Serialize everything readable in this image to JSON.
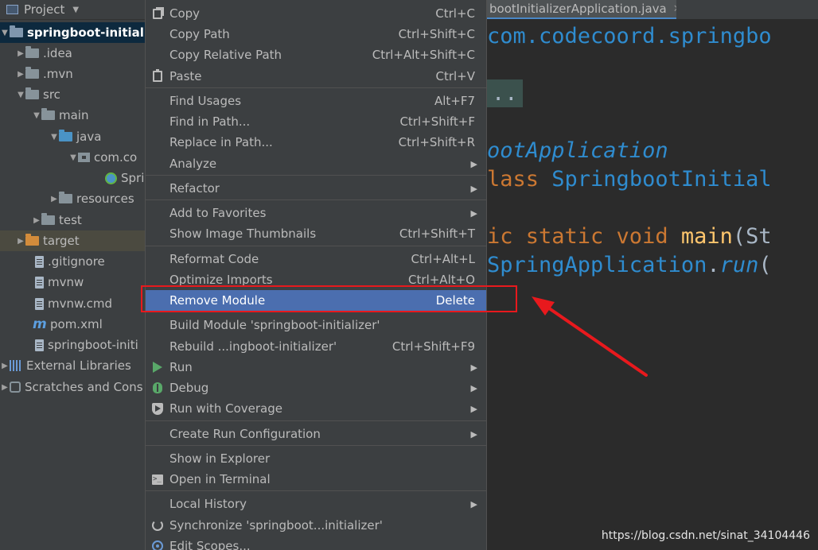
{
  "project_panel": {
    "title": "Project",
    "tree": [
      {
        "label": "springboot-initializ",
        "icon": "module-folder-icon"
      },
      {
        "label": ".idea",
        "icon": "folder-icon"
      },
      {
        "label": ".mvn",
        "icon": "folder-icon"
      },
      {
        "label": "src",
        "icon": "folder-icon"
      },
      {
        "label": "main",
        "icon": "folder-icon"
      },
      {
        "label": "java",
        "icon": "source-folder-icon"
      },
      {
        "label": "com.co",
        "icon": "package-icon"
      },
      {
        "label": "Spri",
        "icon": "spring-class-icon"
      },
      {
        "label": "resources",
        "icon": "resources-folder-icon"
      },
      {
        "label": "test",
        "icon": "folder-icon"
      },
      {
        "label": "target",
        "icon": "excluded-folder-icon"
      },
      {
        "label": ".gitignore",
        "icon": "file-icon"
      },
      {
        "label": "mvnw",
        "icon": "file-icon"
      },
      {
        "label": "mvnw.cmd",
        "icon": "file-icon"
      },
      {
        "label": "pom.xml",
        "icon": "maven-icon"
      },
      {
        "label": "springboot-initi",
        "icon": "file-icon"
      },
      {
        "label": "External Libraries",
        "icon": "libraries-icon"
      },
      {
        "label": "Scratches and Cons",
        "icon": "scratches-icon"
      }
    ]
  },
  "editor": {
    "tab_label": "bootInitializerApplication.java",
    "lines": {
      "l1": "com.codecoord.springbo",
      "l2_fold": "..",
      "l3": "ootApplication",
      "l4_kw": "lass ",
      "l4_name": "SpringbootInitial",
      "l5_kw": "ic static void ",
      "l5_method": "main",
      "l5_rest": "(St",
      "l6_class": "SpringApplication",
      "l6_dot": ".",
      "l6_method": "run",
      "l6_rest": "("
    }
  },
  "context_menu": {
    "items": [
      {
        "label": "Copy",
        "shortcut": "Ctrl+C",
        "icon": "copy-icon"
      },
      {
        "label": "Copy Path",
        "shortcut": "Ctrl+Shift+C"
      },
      {
        "label": "Copy Relative Path",
        "shortcut": "Ctrl+Alt+Shift+C"
      },
      {
        "label": "Paste",
        "shortcut": "Ctrl+V",
        "icon": "paste-icon"
      },
      {
        "label": "Find Usages",
        "shortcut": "Alt+F7"
      },
      {
        "label": "Find in Path...",
        "shortcut": "Ctrl+Shift+F"
      },
      {
        "label": "Replace in Path...",
        "shortcut": "Ctrl+Shift+R"
      },
      {
        "label": "Analyze",
        "submenu": true
      },
      {
        "label": "Refactor",
        "submenu": true
      },
      {
        "label": "Add to Favorites",
        "submenu": true
      },
      {
        "label": "Show Image Thumbnails",
        "shortcut": "Ctrl+Shift+T"
      },
      {
        "label": "Reformat Code",
        "shortcut": "Ctrl+Alt+L"
      },
      {
        "label": "Optimize Imports",
        "shortcut": "Ctrl+Alt+O"
      },
      {
        "label": "Remove Module",
        "shortcut": "Delete",
        "selected": true
      },
      {
        "label": "Build Module 'springboot-initializer'"
      },
      {
        "label": "Rebuild ...ingboot-initializer'",
        "shortcut": "Ctrl+Shift+F9"
      },
      {
        "label": "Run",
        "submenu": true,
        "icon": "run-icon"
      },
      {
        "label": "Debug",
        "submenu": true,
        "icon": "debug-icon"
      },
      {
        "label": "Run with Coverage",
        "submenu": true,
        "icon": "coverage-icon"
      },
      {
        "label": "Create Run Configuration",
        "submenu": true
      },
      {
        "label": "Show in Explorer"
      },
      {
        "label": "Open in Terminal",
        "icon": "terminal-icon"
      },
      {
        "label": "Local History",
        "submenu": true
      },
      {
        "label": "Synchronize 'springboot...initializer'",
        "icon": "sync-icon"
      },
      {
        "label": "Edit Scopes...",
        "icon": "scopes-icon"
      }
    ]
  },
  "annotation": {
    "highlight_color": "#e8191d",
    "watermark": "https://blog.csdn.net/sinat_34104446"
  },
  "colors": {
    "panel_bg": "#3c3f41",
    "editor_bg": "#2b2b2b",
    "selection_bg": "#4b6eaf",
    "accent_blue": "#2f8ccf",
    "keyword_orange": "#cc7832",
    "method_yellow": "#ffc66d"
  }
}
